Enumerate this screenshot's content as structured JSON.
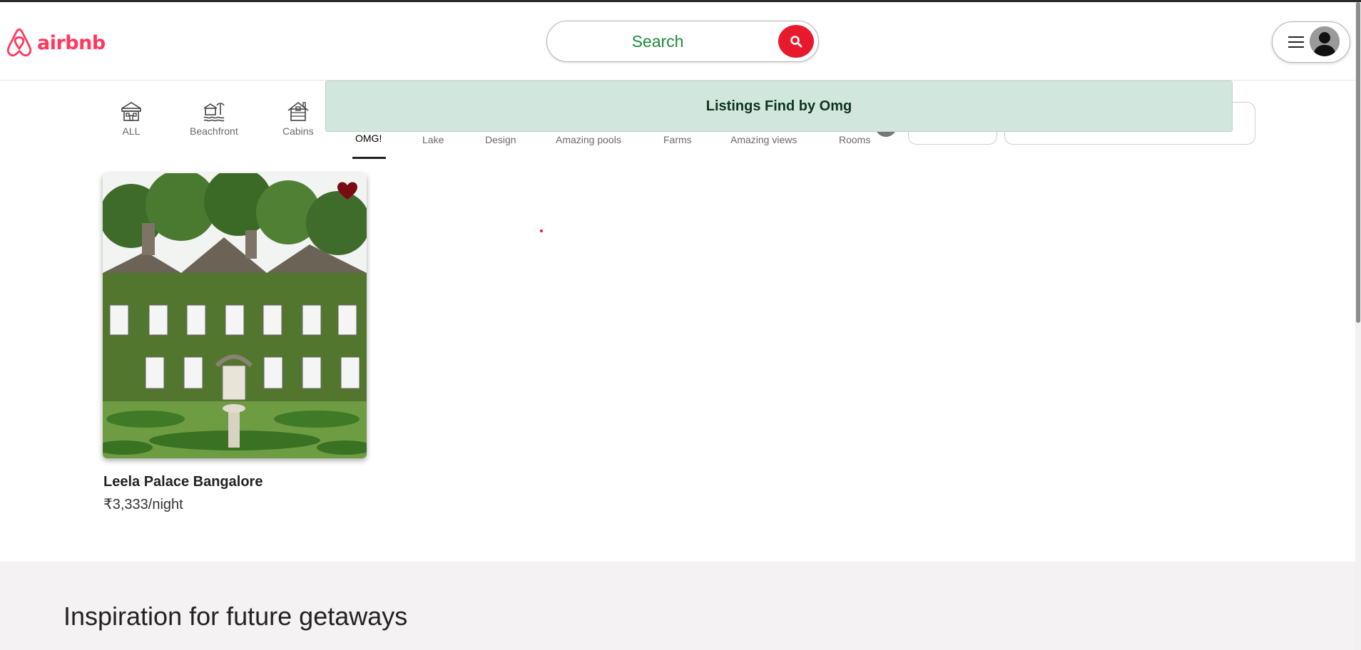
{
  "header": {
    "logo_text": "airbnb",
    "search_label": "Search",
    "brand_color": "#ff385c",
    "search_button_color": "#e8192c"
  },
  "categories": [
    {
      "label": "ALL",
      "icon": "house-icon"
    },
    {
      "label": "Beachfront",
      "icon": "beachfront-icon"
    },
    {
      "label": "Cabins",
      "icon": "cabin-icon"
    },
    {
      "label": "OMG!",
      "icon": "omg-icon",
      "active": true
    },
    {
      "label": "Lake",
      "icon": "lake-icon"
    },
    {
      "label": "Design",
      "icon": "design-icon"
    },
    {
      "label": "Amazing pools",
      "icon": "pool-icon"
    },
    {
      "label": "Farms",
      "icon": "farm-icon"
    },
    {
      "label": "Amazing views",
      "icon": "views-icon"
    },
    {
      "label": "Rooms",
      "icon": "rooms-icon"
    }
  ],
  "toast": {
    "message": "Listings Find by Omg",
    "background": "#d1e7dd"
  },
  "listing": {
    "title": "Leela Palace Bangalore",
    "price": "₹3,333/night",
    "favorited": true
  },
  "footer": {
    "title": "Inspiration for future getaways"
  }
}
